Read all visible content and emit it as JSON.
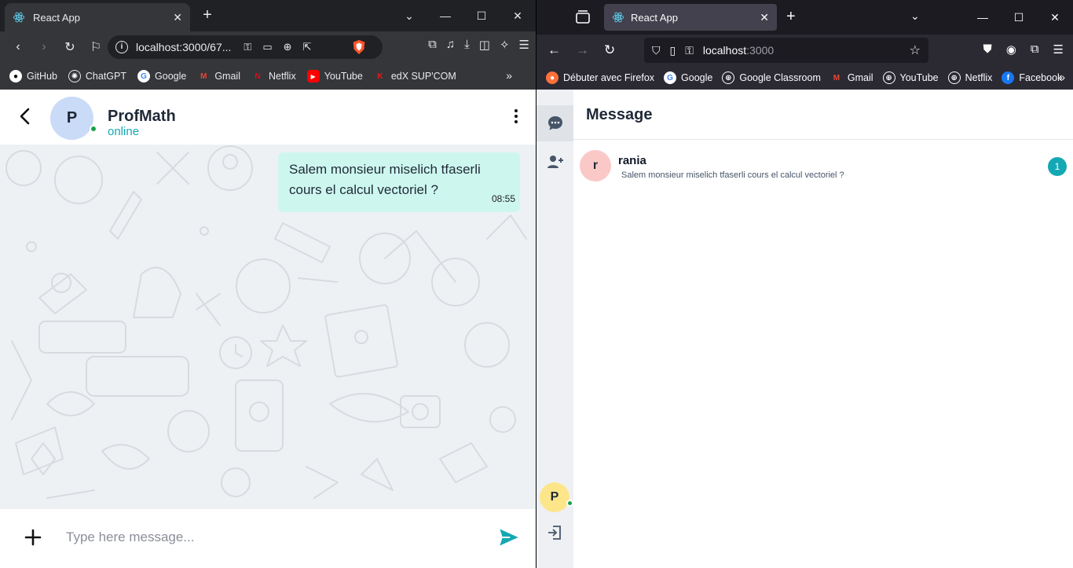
{
  "left_browser": {
    "tab_title": "React App",
    "url": "localhost:3000/67...",
    "bookmarks": [
      {
        "label": "GitHub",
        "icon": "github-icon"
      },
      {
        "label": "ChatGPT",
        "icon": "chatgpt-icon"
      },
      {
        "label": "Google",
        "icon": "google-icon"
      },
      {
        "label": "Gmail",
        "icon": "gmail-icon"
      },
      {
        "label": "Netflix",
        "icon": "netflix-icon"
      },
      {
        "label": "YouTube",
        "icon": "youtube-icon"
      },
      {
        "label": "edX SUP'COM",
        "icon": "edx-icon"
      }
    ]
  },
  "chat": {
    "contact_initial": "P",
    "contact_name": "ProfMath",
    "contact_status": "online",
    "message_text": "Salem monsieur miselich tfaserli cours el calcul vectoriel ?",
    "message_time": "08:55",
    "input_placeholder": "Type here message...",
    "input_value": "",
    "accent_color": "#14a8b4",
    "bubble_color": "#cdf7ee"
  },
  "right_browser": {
    "tab_title": "React App",
    "url_host": "localhost",
    "url_port": ":3000",
    "bookmarks": [
      {
        "label": "Débuter avec Firefox",
        "icon": "firefox-icon"
      },
      {
        "label": "Google",
        "icon": "google-icon"
      },
      {
        "label": "Google Classroom",
        "icon": "globe-icon"
      },
      {
        "label": "Gmail",
        "icon": "gmail-icon"
      },
      {
        "label": "YouTube",
        "icon": "globe-icon"
      },
      {
        "label": "Netflix",
        "icon": "globe-icon"
      },
      {
        "label": "Facebook",
        "icon": "facebook-icon"
      }
    ]
  },
  "messages": {
    "title": "Message",
    "user_initial": "P",
    "conversations": [
      {
        "initial": "r",
        "name": "rania",
        "preview": "Salem monsieur miselich tfaserli cours el calcul vectoriel ?",
        "unread": "1"
      }
    ]
  }
}
